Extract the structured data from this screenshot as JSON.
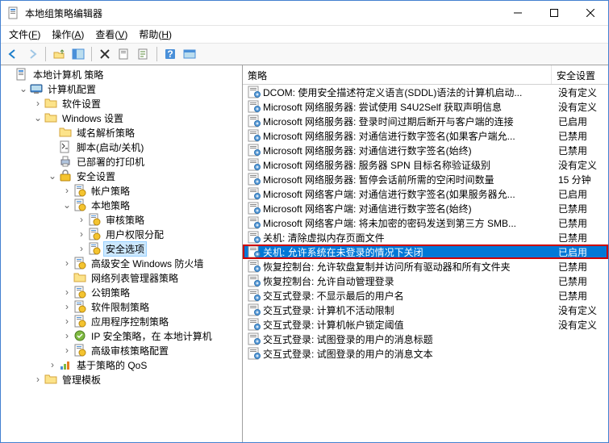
{
  "window": {
    "title": "本地组策略编辑器"
  },
  "menu": [
    {
      "label": "文件",
      "key": "F"
    },
    {
      "label": "操作",
      "key": "A"
    },
    {
      "label": "查看",
      "key": "V"
    },
    {
      "label": "帮助",
      "key": "H"
    }
  ],
  "tree": [
    {
      "lvl": 0,
      "tw": "",
      "ico": "gp",
      "label": "本地计算机 策略",
      "sel": false
    },
    {
      "lvl": 1,
      "tw": "v",
      "ico": "comp",
      "label": "计算机配置",
      "sel": false
    },
    {
      "lvl": 2,
      "tw": ">",
      "ico": "fld",
      "label": "软件设置",
      "sel": false
    },
    {
      "lvl": 2,
      "tw": "v",
      "ico": "fld",
      "label": "Windows 设置",
      "sel": false
    },
    {
      "lvl": 3,
      "tw": "",
      "ico": "fld",
      "label": "域名解析策略",
      "sel": false
    },
    {
      "lvl": 3,
      "tw": "",
      "ico": "scr",
      "label": "脚本(启动/关机)",
      "sel": false
    },
    {
      "lvl": 3,
      "tw": "",
      "ico": "prn",
      "label": "已部署的打印机",
      "sel": false
    },
    {
      "lvl": 3,
      "tw": "v",
      "ico": "sec",
      "label": "安全设置",
      "sel": false
    },
    {
      "lvl": 4,
      "tw": ">",
      "ico": "pol",
      "label": "帐户策略",
      "sel": false
    },
    {
      "lvl": 4,
      "tw": "v",
      "ico": "pol",
      "label": "本地策略",
      "sel": false
    },
    {
      "lvl": 5,
      "tw": ">",
      "ico": "pol",
      "label": "审核策略",
      "sel": false
    },
    {
      "lvl": 5,
      "tw": ">",
      "ico": "pol",
      "label": "用户权限分配",
      "sel": false
    },
    {
      "lvl": 5,
      "tw": ">",
      "ico": "pol",
      "label": "安全选项",
      "sel": true
    },
    {
      "lvl": 4,
      "tw": ">",
      "ico": "pol",
      "label": "高级安全 Windows 防火墙",
      "sel": false
    },
    {
      "lvl": 4,
      "tw": "",
      "ico": "fld",
      "label": "网络列表管理器策略",
      "sel": false
    },
    {
      "lvl": 4,
      "tw": ">",
      "ico": "pol",
      "label": "公钥策略",
      "sel": false
    },
    {
      "lvl": 4,
      "tw": ">",
      "ico": "pol",
      "label": "软件限制策略",
      "sel": false
    },
    {
      "lvl": 4,
      "tw": ">",
      "ico": "pol",
      "label": "应用程序控制策略",
      "sel": false
    },
    {
      "lvl": 4,
      "tw": ">",
      "ico": "ips",
      "label": "IP 安全策略，在 本地计算机",
      "sel": false
    },
    {
      "lvl": 4,
      "tw": ">",
      "ico": "pol",
      "label": "高级审核策略配置",
      "sel": false
    },
    {
      "lvl": 3,
      "tw": ">",
      "ico": "qos",
      "label": "基于策略的 QoS",
      "sel": false
    },
    {
      "lvl": 2,
      "tw": ">",
      "ico": "fld",
      "label": "管理模板",
      "sel": false
    }
  ],
  "columns": {
    "c1": "策略",
    "c2": "安全设置"
  },
  "rows": [
    {
      "t": "DCOM: 使用安全描述符定义语言(SDDL)语法的计算机启动...",
      "s": "没有定义",
      "sel": false
    },
    {
      "t": "Microsoft 网络服务器: 尝试使用 S4U2Self 获取声明信息",
      "s": "没有定义",
      "sel": false
    },
    {
      "t": "Microsoft 网络服务器: 登录时间过期后断开与客户端的连接",
      "s": "已启用",
      "sel": false
    },
    {
      "t": "Microsoft 网络服务器: 对通信进行数字签名(如果客户端允...",
      "s": "已禁用",
      "sel": false
    },
    {
      "t": "Microsoft 网络服务器: 对通信进行数字签名(始终)",
      "s": "已禁用",
      "sel": false
    },
    {
      "t": "Microsoft 网络服务器: 服务器 SPN 目标名称验证级别",
      "s": "没有定义",
      "sel": false
    },
    {
      "t": "Microsoft 网络服务器: 暂停会话前所需的空闲时间数量",
      "s": "15 分钟",
      "sel": false
    },
    {
      "t": "Microsoft 网络客户端: 对通信进行数字签名(如果服务器允...",
      "s": "已启用",
      "sel": false
    },
    {
      "t": "Microsoft 网络客户端: 对通信进行数字签名(始终)",
      "s": "已禁用",
      "sel": false
    },
    {
      "t": "Microsoft 网络客户端: 将未加密的密码发送到第三方 SMB...",
      "s": "已禁用",
      "sel": false
    },
    {
      "t": "关机: 清除虚拟内存页面文件",
      "s": "已禁用",
      "sel": false
    },
    {
      "t": "关机: 允许系统在未登录的情况下关闭",
      "s": "已启用",
      "sel": true
    },
    {
      "t": "恢复控制台: 允许软盘复制并访问所有驱动器和所有文件夹",
      "s": "已禁用",
      "sel": false
    },
    {
      "t": "恢复控制台: 允许自动管理登录",
      "s": "已禁用",
      "sel": false
    },
    {
      "t": "交互式登录: 不显示最后的用户名",
      "s": "已禁用",
      "sel": false
    },
    {
      "t": "交互式登录: 计算机不活动限制",
      "s": "没有定义",
      "sel": false
    },
    {
      "t": "交互式登录: 计算机帐户锁定阈值",
      "s": "没有定义",
      "sel": false
    },
    {
      "t": "交互式登录: 试图登录的用户的消息标题",
      "s": "",
      "sel": false
    },
    {
      "t": "交互式登录: 试图登录的用户的消息文本",
      "s": "",
      "sel": false
    }
  ]
}
